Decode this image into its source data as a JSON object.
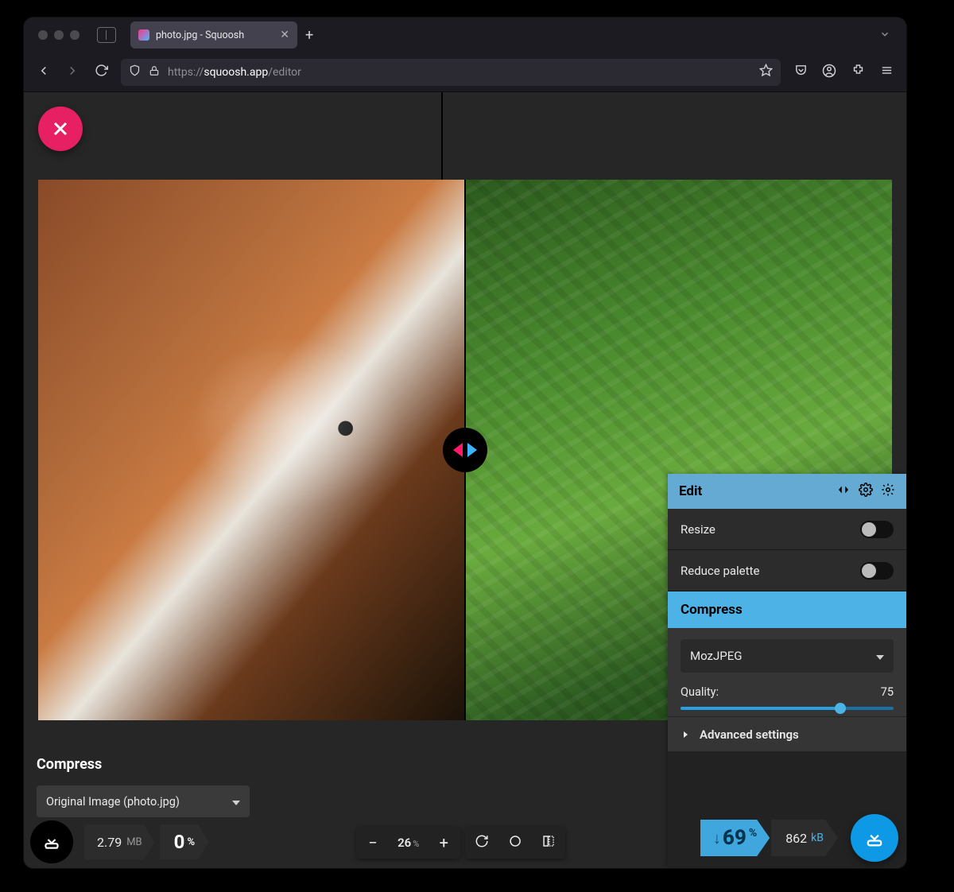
{
  "browser": {
    "tab_title": "photo.jpg - Squoosh",
    "url_prefix": "https://",
    "url_host": "squoosh.app",
    "url_path": "/editor"
  },
  "editor": {
    "left": {
      "section_label": "Compress",
      "codec_selected": "Original Image (photo.jpg)",
      "size_value": "2.79",
      "size_unit": "MB",
      "reduction_value": "0",
      "reduction_unit": "%"
    },
    "right": {
      "header_label": "Edit",
      "resize_label": "Resize",
      "reduce_palette_label": "Reduce palette",
      "compress_label": "Compress",
      "codec_selected": "MozJPEG",
      "quality_label": "Quality:",
      "quality_value": "75",
      "advanced_label": "Advanced settings",
      "reduction_value": "69",
      "reduction_unit": "%",
      "size_value": "862",
      "size_unit": "kB"
    },
    "zoom": {
      "value": "26",
      "unit": "%"
    }
  }
}
